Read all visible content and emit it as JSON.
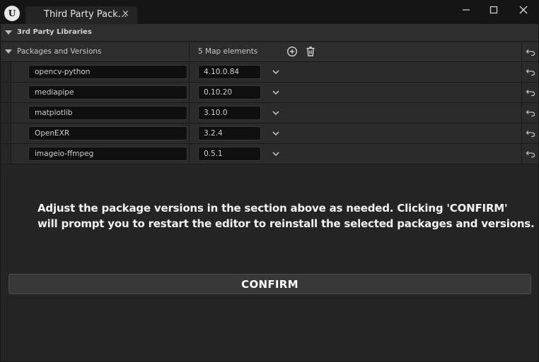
{
  "window": {
    "tab_title": "Third Party Pack…",
    "tab_close_glyph": "×",
    "logo_glyph": "U",
    "minimize_icon": "minimize-icon",
    "maximize_icon": "maximize-icon",
    "close_icon": "close-icon"
  },
  "section": {
    "title": "3rd Party Libraries"
  },
  "map_property": {
    "label": "Packages and Versions",
    "count_text": "5 Map elements",
    "add_icon": "plus-circle-icon",
    "remove_icon": "trash-icon",
    "reset_icon": "reset-arrow-icon"
  },
  "packages": [
    {
      "name": "opencv-python",
      "version": "4.10.0.84"
    },
    {
      "name": "mediapipe",
      "version": "0.10.20"
    },
    {
      "name": "matplotlib",
      "version": "3.10.0"
    },
    {
      "name": "OpenEXR",
      "version": "3.2.4"
    },
    {
      "name": "imageio-ffmpeg",
      "version": "0.5.1"
    }
  ],
  "message": {
    "line1": "Adjust the package versions in the section above as needed. Clicking 'CONFIRM'",
    "line2": "will prompt you to restart the editor to reinstall the selected packages and versions."
  },
  "confirm_button": {
    "label": "CONFIRM"
  },
  "colors": {
    "background": "#151515",
    "panel": "#242424",
    "input_bg": "#0f0f0f",
    "text": "#c8c8c8",
    "button_bg": "#383838"
  }
}
